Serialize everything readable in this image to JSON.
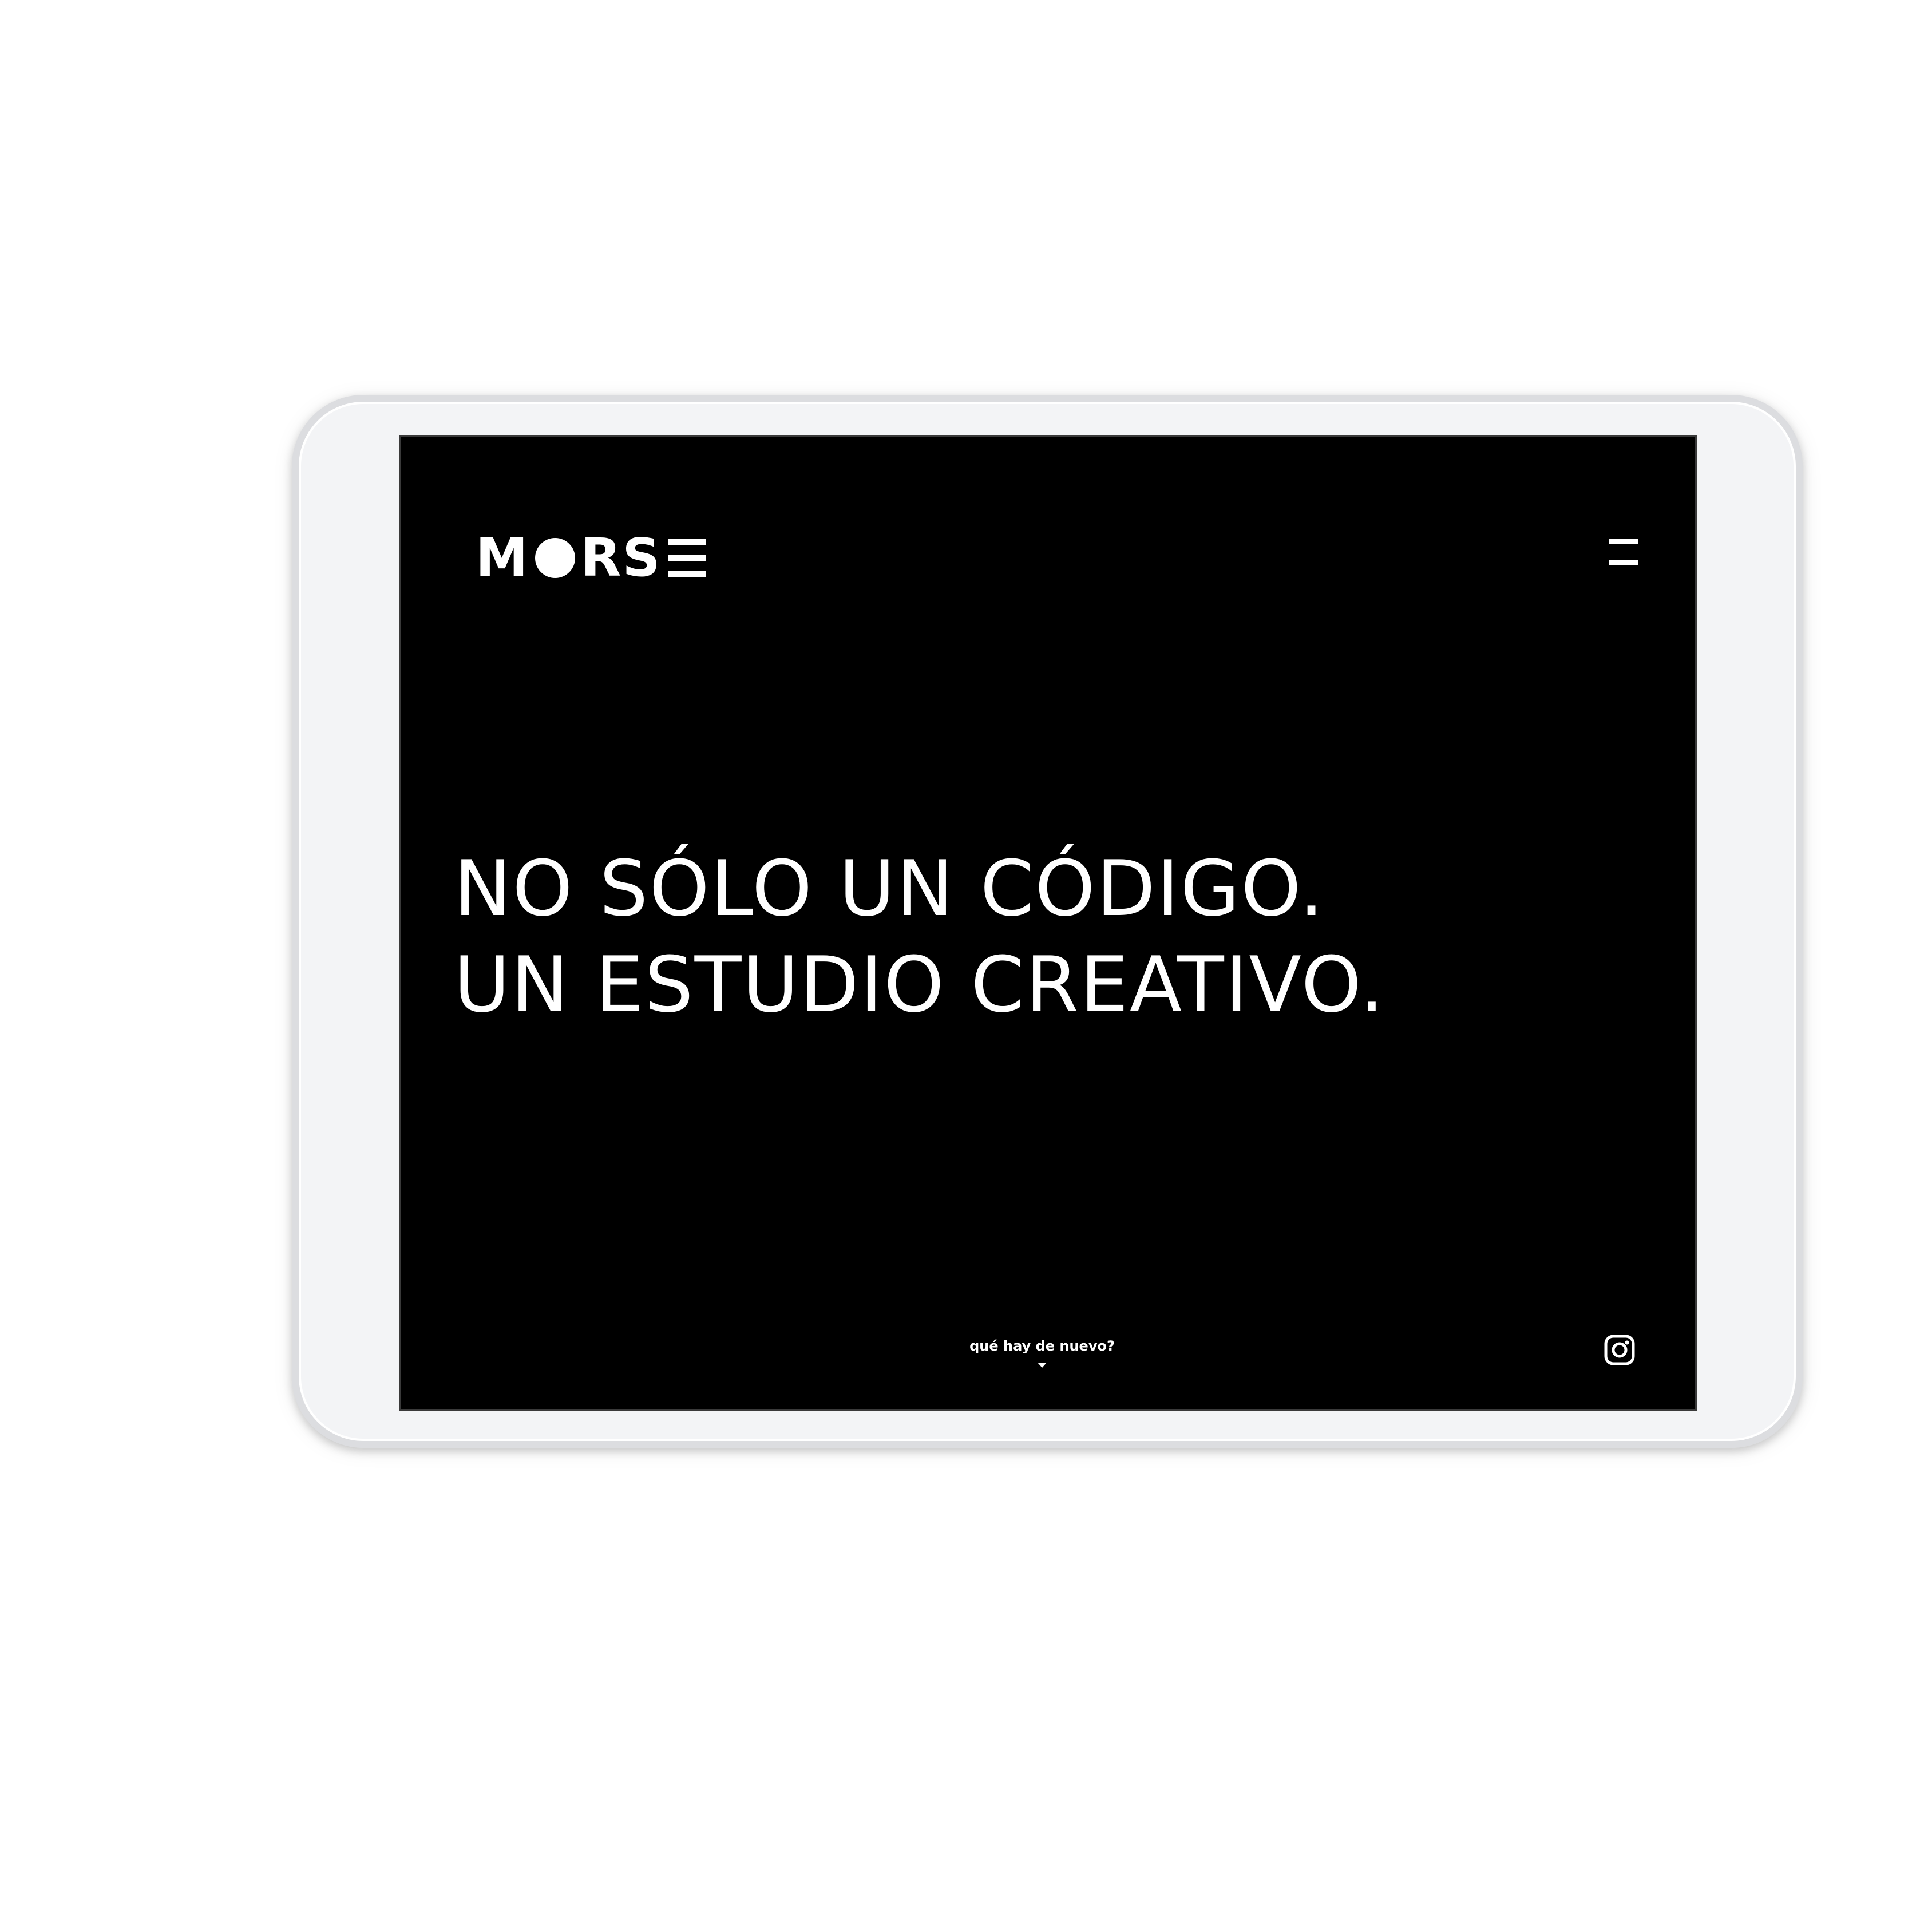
{
  "header": {
    "logo_text": "MORSE"
  },
  "hero": {
    "line1": "NO SÓLO UN CÓDIGO.",
    "line2": "UN ESTUDIO CREATIVO."
  },
  "footer": {
    "news_link": "qué hay de nuevo?"
  },
  "icons": {
    "menu": "hamburger-menu-icon",
    "scroll": "caret-down-icon",
    "social": "instagram-icon"
  },
  "colors": {
    "screen_background": "#000000",
    "text": "#ffffff",
    "device_frame": "#f3f4f6"
  }
}
